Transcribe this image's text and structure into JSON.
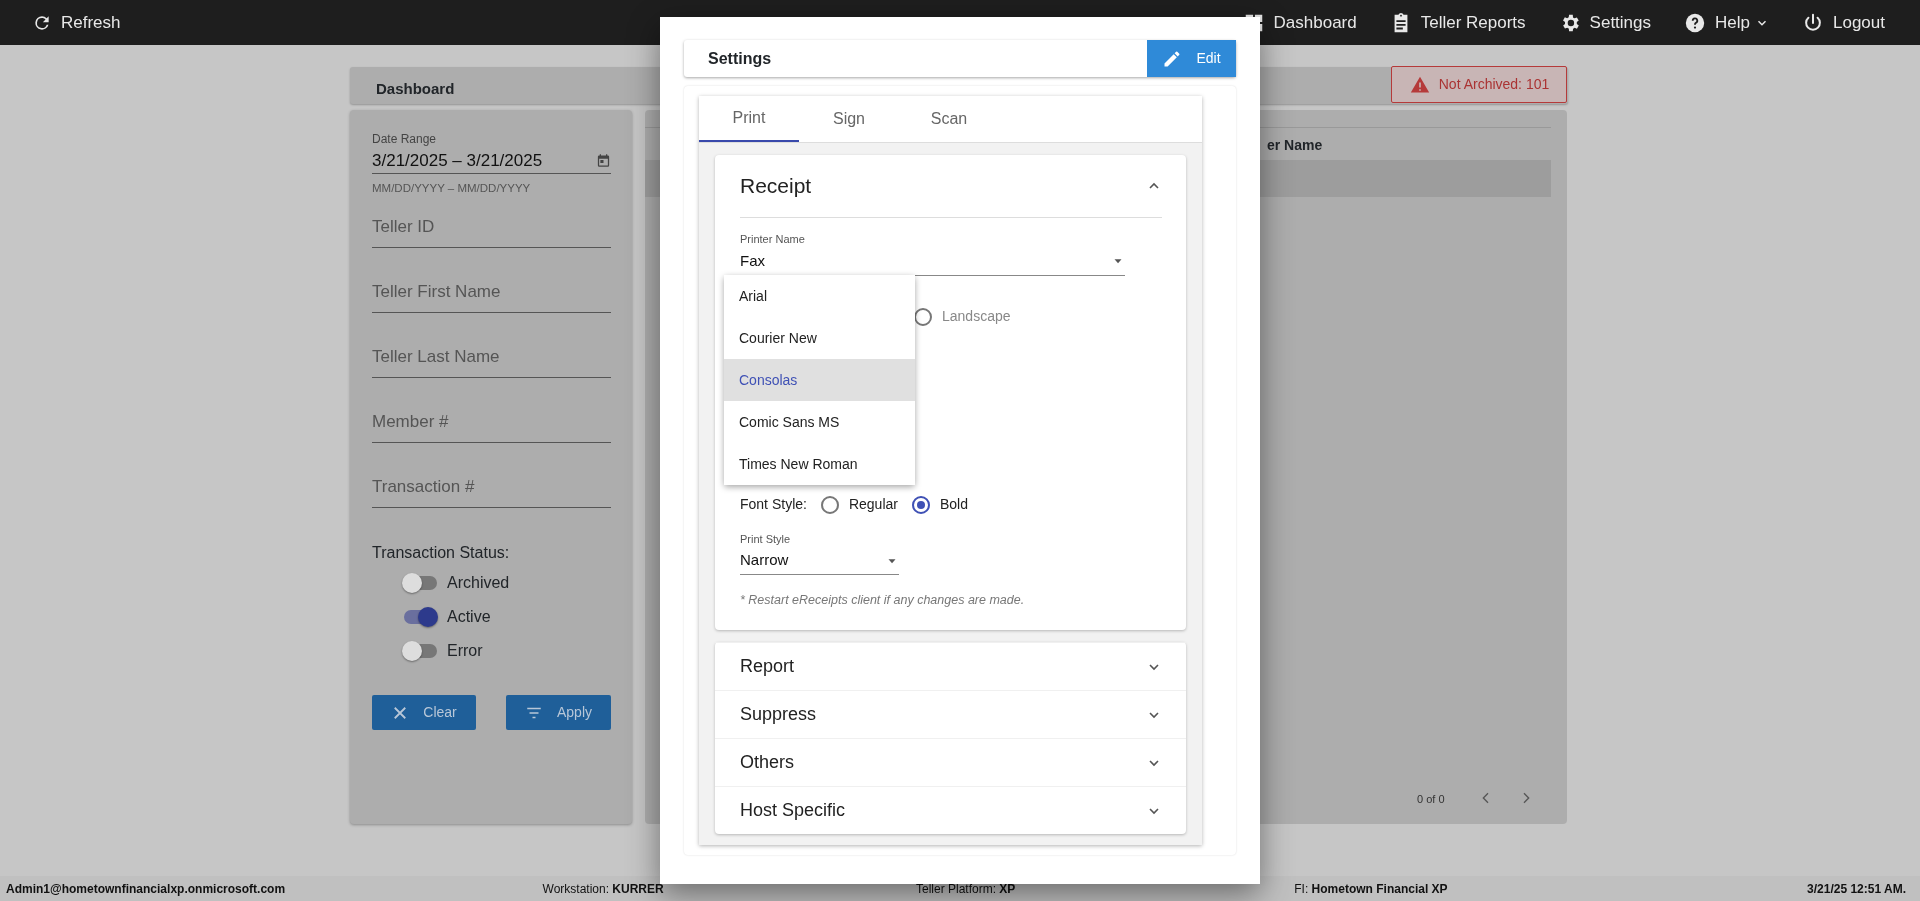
{
  "navbar": {
    "refresh": "Refresh",
    "items": [
      {
        "label": "Dashboard",
        "dropdown": false
      },
      {
        "label": "Teller Reports",
        "dropdown": false
      },
      {
        "label": "Settings",
        "dropdown": false
      },
      {
        "label": "Help",
        "dropdown": true
      },
      {
        "label": "Logout",
        "dropdown": false
      }
    ]
  },
  "dashboard": {
    "title": "Dashboard",
    "alert": "Not Archived: 101"
  },
  "filters": {
    "date_range": {
      "label": "Date Range",
      "value": "3/21/2025 – 3/21/2025",
      "hint": "MM/DD/YYYY – MM/DD/YYYY"
    },
    "fields": [
      {
        "placeholder": "Teller ID"
      },
      {
        "placeholder": "Teller First Name"
      },
      {
        "placeholder": "Teller Last Name"
      },
      {
        "placeholder": "Member #"
      },
      {
        "placeholder": "Transaction #"
      }
    ],
    "status": {
      "label": "Transaction Status:",
      "toggles": [
        {
          "label": "Archived",
          "on": false
        },
        {
          "label": "Active",
          "on": true
        },
        {
          "label": "Error",
          "on": false
        }
      ]
    },
    "buttons": [
      "Clear",
      "Apply"
    ]
  },
  "table": {
    "columns": [
      "er Name"
    ]
  },
  "pagination": {
    "range": "0 of 0"
  },
  "modal": {
    "title": "Settings",
    "edit": "Edit",
    "tabs": [
      {
        "label": "Print",
        "selected": true
      },
      {
        "label": "Sign",
        "selected": false
      },
      {
        "label": "Scan",
        "selected": false
      }
    ],
    "sections": [
      {
        "title": "Receipt",
        "expanded": true,
        "printer": {
          "label": "Printer Name",
          "value": "Fax"
        },
        "orientation": [
          {
            "label": "Landscape",
            "selected": false
          }
        ],
        "font_menu": [
          {
            "label": "Arial",
            "selected": false
          },
          {
            "label": "Courier New",
            "selected": false
          },
          {
            "label": "Consolas",
            "selected": true
          },
          {
            "label": "Comic Sans MS",
            "selected": false
          },
          {
            "label": "Times New Roman",
            "selected": false
          }
        ],
        "font_style": {
          "label": "Font Style:",
          "options": [
            {
              "label": "Regular",
              "selected": false
            },
            {
              "label": "Bold",
              "selected": true
            }
          ]
        },
        "print_style": {
          "label": "Print Style",
          "value": "Narrow"
        },
        "note": "* Restart eReceipts client if any changes are made."
      },
      {
        "title": "Report",
        "expanded": false
      },
      {
        "title": "Suppress",
        "expanded": false
      },
      {
        "title": "Others",
        "expanded": false
      },
      {
        "title": "Host Specific",
        "expanded": false
      }
    ]
  },
  "status_bar": {
    "user": "Admin1@hometownfinancialxp.onmicrosoft.com",
    "items": [
      {
        "label": "Workstation:",
        "value": "KURRER"
      },
      {
        "label": "Teller Platform:",
        "value": "XP"
      },
      {
        "label": "FI:",
        "value": "Hometown Financial XP"
      }
    ],
    "datetime": "3/21/25 12:51 AM."
  }
}
